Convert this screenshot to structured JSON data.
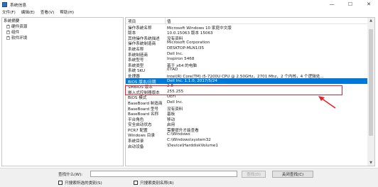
{
  "window": {
    "title": "系统信息",
    "minimize": "—",
    "maximize": "☐",
    "close": "✕"
  },
  "menu": [
    "文件(F)",
    "编辑(E)",
    "查看(V)",
    "帮助(H)"
  ],
  "tree": {
    "root": "系统摘要",
    "children": [
      {
        "label": "硬件资源",
        "expander": "+"
      },
      {
        "label": "组件",
        "expander": "+"
      },
      {
        "label": "软件环境",
        "expander": "+"
      }
    ]
  },
  "grid": {
    "headers": {
      "item": "项目",
      "value": "值"
    },
    "rows": [
      {
        "item": "操作系统名称",
        "value": "Microsoft Windows 10 家庭中文版",
        "selected": false
      },
      {
        "item": "版本",
        "value": "10.0.15063 版本 15063",
        "selected": false
      },
      {
        "item": "其他操作系统描述",
        "value": "没有资料",
        "selected": false
      },
      {
        "item": "操作系统制造商",
        "value": "Microsoft Corporation",
        "selected": false
      },
      {
        "item": "系统名称",
        "value": "DESKTOP-MLN1I35",
        "selected": false
      },
      {
        "item": "系统制造商",
        "value": "Dell Inc.",
        "selected": false
      },
      {
        "item": "系统型号",
        "value": "Inspiron 5468",
        "selected": false
      },
      {
        "item": "系统类型",
        "value": "基于 x64 的电脑",
        "selected": false
      },
      {
        "item": "系统 SKU",
        "value": "07AD",
        "selected": false
      },
      {
        "item": "处理器",
        "value": "Intel(R) Core(TM) i5-7200U CPU @ 2.50GHz，2701 Mhz，2 个内核，4 个逻辑处...",
        "selected": false
      },
      {
        "item": "BIOS 版本/日期",
        "value": "Dell Inc. 1.1.0, 2017/5/24",
        "selected": true
      },
      {
        "item": "SMBIOS 版本",
        "value": "2.8",
        "selected": false
      },
      {
        "item": "嵌入式控制器版本",
        "value": "255.255",
        "selected": false
      },
      {
        "item": "BIOS 模式",
        "value": "UEFI",
        "selected": false
      },
      {
        "item": "BaseBoard 制造商",
        "value": "Dell Inc.",
        "selected": false
      },
      {
        "item": "BaseBoard 型号",
        "value": "没有资料",
        "selected": false
      },
      {
        "item": "BaseBoard 名称",
        "value": "基板",
        "selected": false
      },
      {
        "item": "平台角色",
        "value": "移动",
        "selected": false
      },
      {
        "item": "安全启动状态",
        "value": "启用",
        "selected": false
      },
      {
        "item": "PCR7 配置",
        "value": "需要提升才能查看",
        "selected": false
      },
      {
        "item": "Windows 目录",
        "value": "C:\\Windows",
        "selected": false
      },
      {
        "item": "系统目录",
        "value": "C:\\Windows\\system32",
        "selected": false
      },
      {
        "item": "启动设备",
        "value": "\\Device\\HarddiskVolume1",
        "selected": false
      }
    ]
  },
  "scrollbar": {
    "up": "▲",
    "down": "▼"
  },
  "find": {
    "label": "查找什么(W):",
    "value": "",
    "find_button": "查找(D)",
    "close_find_button": "关闭查找(C)",
    "checkbox_selected_category": "只搜索所选的类别(S)",
    "checkbox_category_names": "只搜索类别名称(R)"
  },
  "annotation": {
    "color": "#e8212b"
  }
}
